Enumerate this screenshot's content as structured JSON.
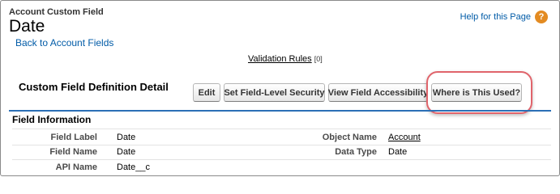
{
  "header": {
    "subtitle": "Account Custom Field",
    "title": "Date",
    "back_link": "Back to Account Fields",
    "help_link": "Help for this Page",
    "help_icon": "question-mark-icon"
  },
  "related": {
    "validation_rules_label": "Validation Rules",
    "validation_rules_count": "[0]"
  },
  "detail": {
    "section_title": "Custom Field Definition Detail",
    "buttons": {
      "edit": "Edit",
      "field_level_security": "Set Field-Level Security",
      "view_field_accessibility": "View Field Accessibility",
      "where_used": "Where is This Used?"
    },
    "highlight_color": "#e0646b"
  },
  "field_information": {
    "title": "Field Information",
    "field_label_label": "Field Label",
    "field_label_value": "Date",
    "object_name_label": "Object Name",
    "object_name_value": "Account",
    "field_name_label": "Field Name",
    "field_name_value": "Date",
    "data_type_label": "Data Type",
    "data_type_value": "Date",
    "api_name_label": "API Name",
    "api_name_value": "Date__c"
  },
  "colors": {
    "link": "#015ba7",
    "section_divider": "#2b6fb6",
    "help_icon": "#e38b22"
  }
}
